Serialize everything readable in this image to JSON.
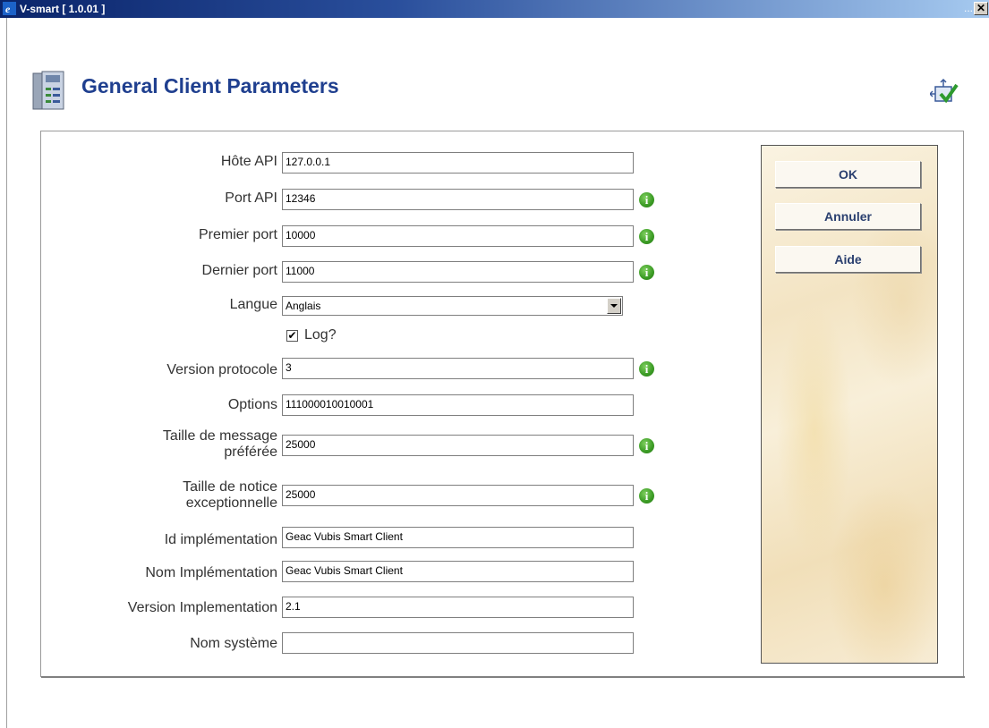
{
  "window": {
    "title": "V-smart [ 1.0.01 ]",
    "dots": "...",
    "close": "✕"
  },
  "page": {
    "title": "General Client Parameters"
  },
  "form": {
    "host_label": "Hôte API",
    "host_value": "127.0.0.1",
    "port_label": "Port API",
    "port_value": "12346",
    "first_port_label": "Premier port",
    "first_port_value": "10000",
    "last_port_label": "Dernier port",
    "last_port_value": "11000",
    "language_label": "Langue",
    "language_value": "Anglais",
    "log_label": "Log?",
    "log_checked": "☑",
    "protocol_label": "Version protocole",
    "protocol_value": "3",
    "options_label": "Options",
    "options_value": "111000010010001",
    "msg_size_label_1": "Taille de message",
    "msg_size_label_2": "préférée",
    "msg_size_value": "25000",
    "record_size_label_1": "Taille de notice",
    "record_size_label_2": "exceptionnelle",
    "record_size_value": "25000",
    "impl_id_label": "Id implémentation",
    "impl_id_value": "Geac Vubis Smart Client",
    "impl_name_label": "Nom Implémentation",
    "impl_name_value": "Geac Vubis Smart Client",
    "impl_version_label": "Version Implementation",
    "impl_version_value": "2.1",
    "system_name_label": "Nom système",
    "system_name_value": ""
  },
  "buttons": {
    "ok": "OK",
    "cancel": "Annuler",
    "help": "Aide"
  },
  "info_glyph": "i"
}
